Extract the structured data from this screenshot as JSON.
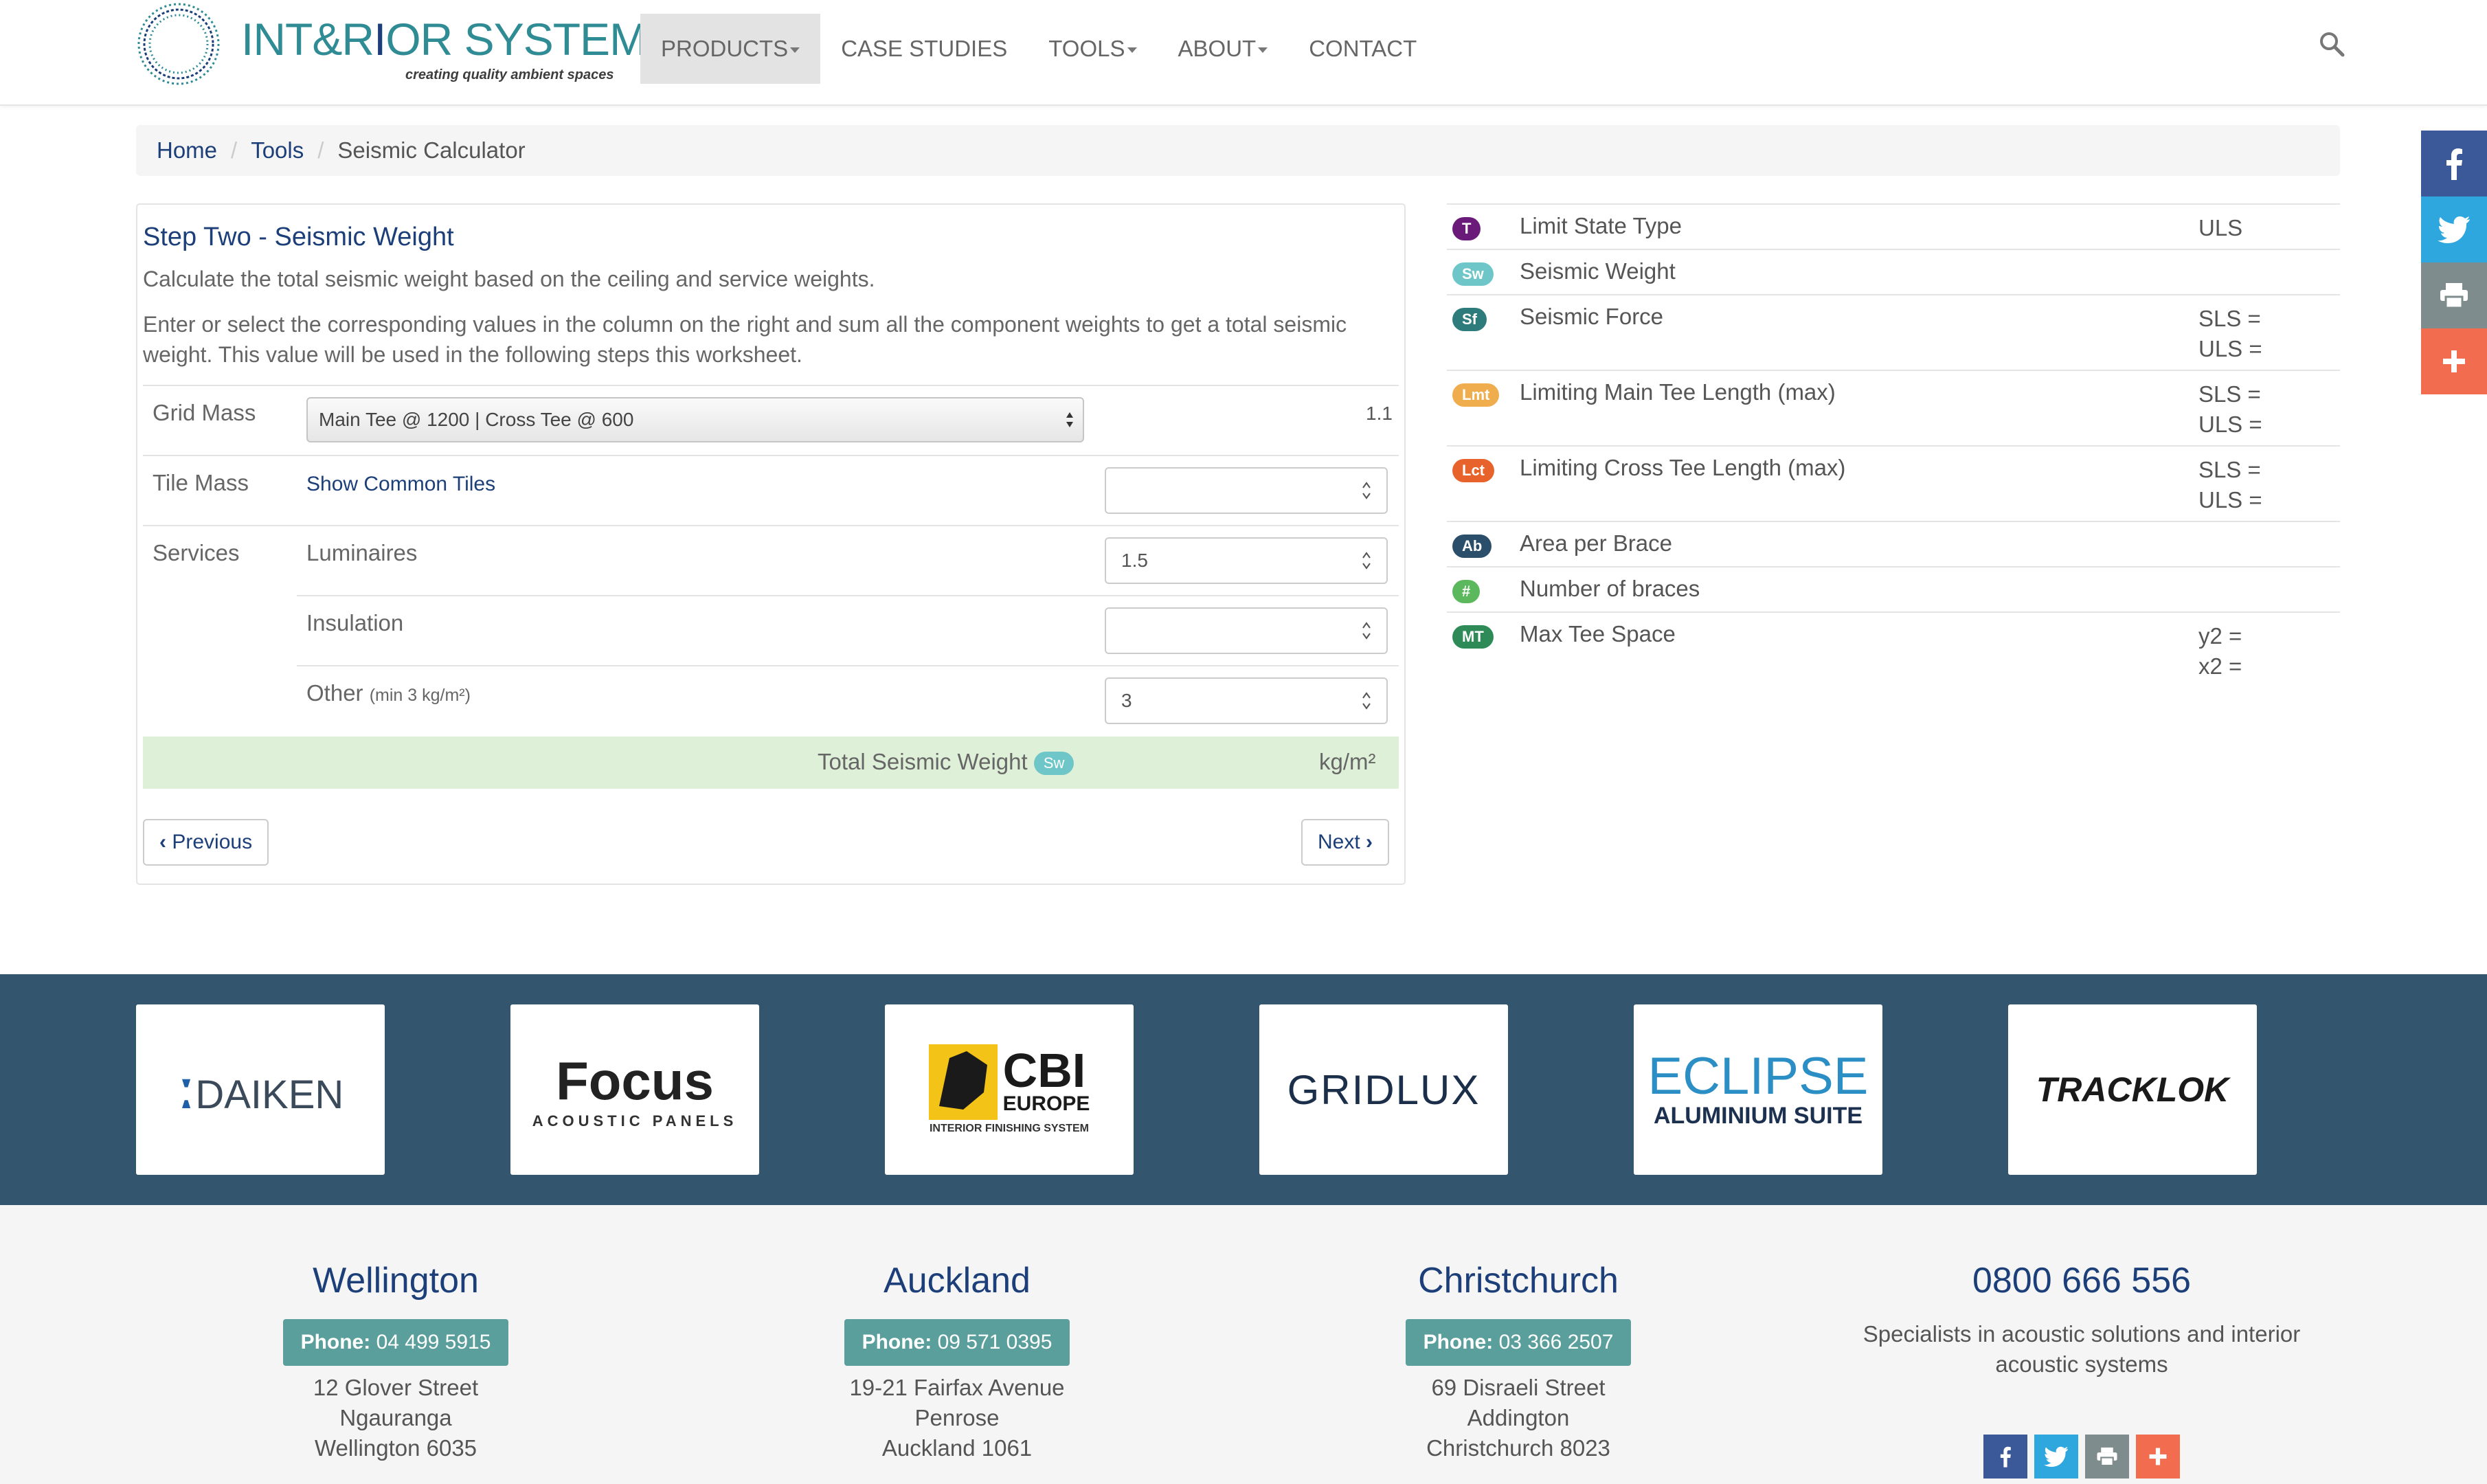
{
  "brand": {
    "name_part1": "INT&R",
    "name_part2": "I",
    "name_part3": "OR SYSTEMS",
    "tagline": "creating quality ambient spaces"
  },
  "nav": {
    "items": [
      {
        "label": "PRODUCTS",
        "dropdown": true,
        "active": true
      },
      {
        "label": "CASE STUDIES",
        "dropdown": false,
        "active": false
      },
      {
        "label": "TOOLS",
        "dropdown": true,
        "active": false
      },
      {
        "label": "ABOUT",
        "dropdown": true,
        "active": false
      },
      {
        "label": "CONTACT",
        "dropdown": false,
        "active": false
      }
    ],
    "search_icon": "search-icon"
  },
  "breadcrumb": {
    "home": "Home",
    "tools": "Tools",
    "current": "Seismic Calculator"
  },
  "step": {
    "title": "Step Two - Seismic Weight",
    "desc1": "Calculate the total seismic weight based on the ceiling and service weights.",
    "desc2": "Enter or select the corresponding values in the column on the right and sum all the component weights to get a total seismic weight. This value will be used in the following steps this worksheet.",
    "grid_mass": {
      "label": "Grid Mass",
      "selected": "Main Tee @ 1200 | Cross Tee @ 600",
      "value": "1.1"
    },
    "tile_mass": {
      "label": "Tile Mass",
      "link": "Show Common Tiles",
      "value": ""
    },
    "services": {
      "label": "Services",
      "luminaires": {
        "label": "Luminaires",
        "value": "1.5"
      },
      "insulation": {
        "label": "Insulation",
        "value": ""
      },
      "other": {
        "label": "Other",
        "hint": "(min 3 kg/m²)",
        "value": "3"
      }
    },
    "total": {
      "label": "Total Seismic Weight",
      "badge": "Sw",
      "unit": "kg/m²"
    },
    "prev_label": "Previous",
    "next_label": "Next"
  },
  "summary": [
    {
      "badge": "T",
      "color": "#6a1b7a",
      "label": "Limit State Type",
      "values": [
        "ULS"
      ]
    },
    {
      "badge": "Sw",
      "color": "#6ec6c9",
      "label": "Seismic Weight",
      "values": []
    },
    {
      "badge": "Sf",
      "color": "#2e7b7b",
      "label": "Seismic Force",
      "values": [
        "SLS =",
        "ULS ="
      ]
    },
    {
      "badge": "Lmt",
      "color": "#f0ad4e",
      "label": "Limiting Main Tee Length (max)",
      "values": [
        "SLS =",
        "ULS ="
      ]
    },
    {
      "badge": "Lct",
      "color": "#e8632b",
      "label": "Limiting Cross Tee Length (max)",
      "values": [
        "SLS =",
        "ULS ="
      ]
    },
    {
      "badge": "Ab",
      "color": "#2b4e6b",
      "label": "Area per Brace",
      "values": []
    },
    {
      "badge": "#",
      "color": "#5cb85c",
      "label": "Number of braces",
      "values": []
    },
    {
      "badge": "MT",
      "color": "#2e8b57",
      "label": "Max Tee Space",
      "values": [
        "y2 =",
        "x2 ="
      ]
    }
  ],
  "suppliers": [
    {
      "name": "DAIKEN"
    },
    {
      "name": "Focus",
      "sub": "ACOUSTIC PANELS"
    },
    {
      "name": "CBI",
      "sub": "EUROPE",
      "sub2": "INTERIOR FINISHING SYSTEM"
    },
    {
      "name": "GRIDLUX"
    },
    {
      "name": "ECLIPSE",
      "sub": "ALUMINIUM SUITE"
    },
    {
      "name": "TRACKLOK"
    }
  ],
  "offices": [
    {
      "city": "Wellington",
      "phone_label": "Phone:",
      "phone": "04 499 5915",
      "addr1": "12 Glover Street",
      "addr2": "Ngauranga",
      "addr3": "Wellington 6035"
    },
    {
      "city": "Auckland",
      "phone_label": "Phone:",
      "phone": "09 571 0395",
      "addr1": "19-21 Fairfax Avenue",
      "addr2": "Penrose",
      "addr3": "Auckland 1061"
    },
    {
      "city": "Christchurch",
      "phone_label": "Phone:",
      "phone": "03 366 2507",
      "addr1": "69 Disraeli Street",
      "addr2": "Addington",
      "addr3": "Christchurch 8023"
    }
  ],
  "contact": {
    "phone": "0800 666 556",
    "tagline": "Specialists in acoustic solutions and interior acoustic systems"
  },
  "colors": {
    "brand_blue": "#1c3f79",
    "brand_teal": "#2f8b94",
    "band": "#33566e",
    "total_row": "#dff0d8",
    "facebook": "#3b5998",
    "twitter": "#2ea7df",
    "print": "#7f8c8d",
    "add": "#f26c4f"
  }
}
